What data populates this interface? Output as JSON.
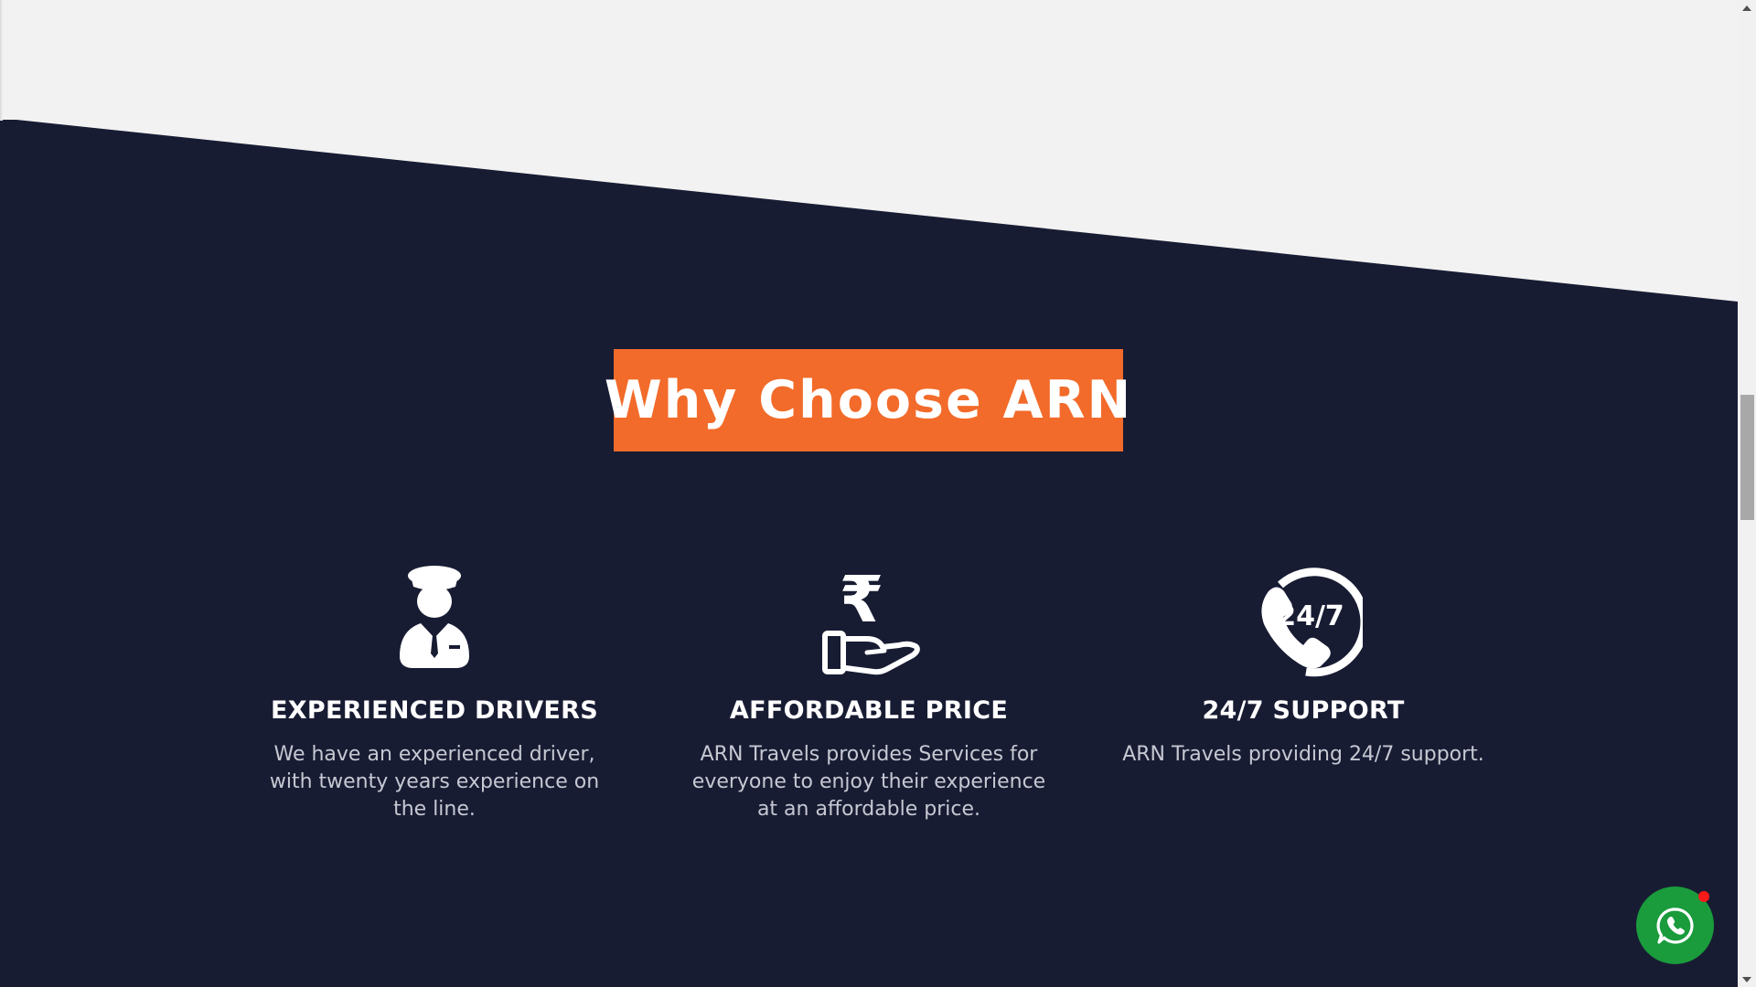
{
  "section": {
    "title": "Why Choose ARN",
    "colors": {
      "navy": "#181c33",
      "accent": "#f26b2a",
      "whatsapp": "#1a9b3c",
      "light_bg": "#f2f2f2"
    }
  },
  "features": [
    {
      "icon": "chauffeur-icon",
      "title": "EXPERIENCED DRIVERS",
      "description": "We have an experienced driver, with twenty years experience on the line."
    },
    {
      "icon": "rupee-hand-icon",
      "title": "AFFORDABLE PRICE",
      "description": "ARN Travels provides Services for everyone to enjoy their experience at an affordable price."
    },
    {
      "icon": "support-24-7-icon",
      "title": "24/7 SUPPORT",
      "description": "ARN Travels providing 24/7 support."
    }
  ],
  "support_icon_text": "24/7",
  "rupee_symbol": "₹",
  "whatsapp": {
    "icon": "whatsapp-icon"
  },
  "scrollbar": {
    "up_icon": "arrow-up-icon",
    "down_icon": "arrow-down-icon"
  }
}
